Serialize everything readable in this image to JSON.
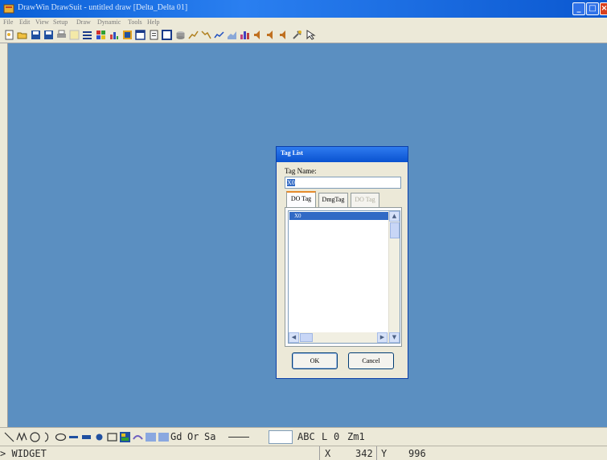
{
  "window": {
    "title": "DrawWin DrawSuit - untitled draw [Delta_Delta 01]"
  },
  "menubar": {
    "items": [
      "File",
      "Edit",
      "View",
      "Setup",
      "Draw",
      "Dynamic",
      "Tools",
      "Help"
    ]
  },
  "dialog": {
    "title": "Tag List",
    "tag_name_label": "Tag Name:",
    "tag_name_value": "X0",
    "tabs": [
      "DO Tag",
      "DmgTag",
      "DO Tag"
    ],
    "list_items": [
      "X0"
    ],
    "ok_label": "OK",
    "cancel_label": "Cancel"
  },
  "drawbar": {
    "labels": {
      "gd": "Gd",
      "or": "Or",
      "sa": "Sa",
      "abc": "ABC",
      "layer": "L",
      "layer_value": "0",
      "zoom": "Zm1"
    }
  },
  "status": {
    "prompt": "> WIDGET",
    "x_label": "X",
    "x_value": "342",
    "y_label": "Y",
    "y_value": "996"
  },
  "colors": {
    "canvas": "#5b8fc1",
    "title_bar": "#0a5fd6",
    "chrome": "#ece9d8",
    "selection": "#316ac5"
  }
}
